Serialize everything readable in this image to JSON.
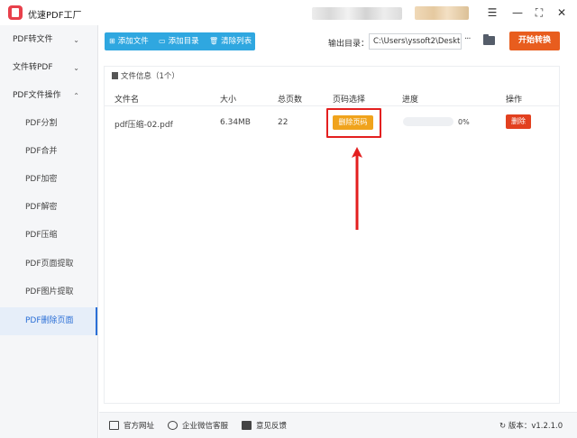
{
  "app": {
    "title": "优速PDF工厂"
  },
  "window_controls": {
    "menu": "☰",
    "minimize": "—",
    "maximize": "⛶",
    "close": "✕"
  },
  "sidebar": {
    "groups": [
      {
        "label": "PDF转文件",
        "chevron": "⌄"
      },
      {
        "label": "文件转PDF",
        "chevron": "⌄"
      },
      {
        "label": "PDF文件操作",
        "chevron": "⌃"
      }
    ],
    "sub_items": [
      "PDF分割",
      "PDF合并",
      "PDF加密",
      "PDF解密",
      "PDF压缩",
      "PDF页面提取",
      "PDF图片提取",
      "PDF删除页面"
    ],
    "active_item": "PDF删除页面"
  },
  "toolbar": {
    "add_file": "添加文件",
    "add_folder": "添加目录",
    "clear_list": "清除列表",
    "output_label": "输出目录：",
    "output_path": "C:\\Users\\yssoft2\\Deskt",
    "more": "···",
    "start": "开始转换"
  },
  "file_info": {
    "label": "文件信息（1个）"
  },
  "table": {
    "headers": [
      "文件名",
      "大小",
      "总页数",
      "页码选择",
      "进度",
      "操作"
    ],
    "rows": [
      {
        "filename": "pdf压缩-02.pdf",
        "size": "6.34MB",
        "pages": "22",
        "page_select_label": "删除页码",
        "progress": 0,
        "progress_text": "0%",
        "action_label": "删除"
      }
    ]
  },
  "statusbar": {
    "website": "官方网址",
    "wechat": "企业微信客服",
    "feedback": "意见反馈",
    "version": "版本：v1.2.1.0"
  },
  "colors": {
    "accent": "#2fa7e0",
    "start_button": "#e85d1e",
    "page_select_button": "#f0a31c",
    "delete_button": "#e2401f",
    "highlight": "#e31f1f",
    "active_sidebar": "#2b6fd6"
  }
}
